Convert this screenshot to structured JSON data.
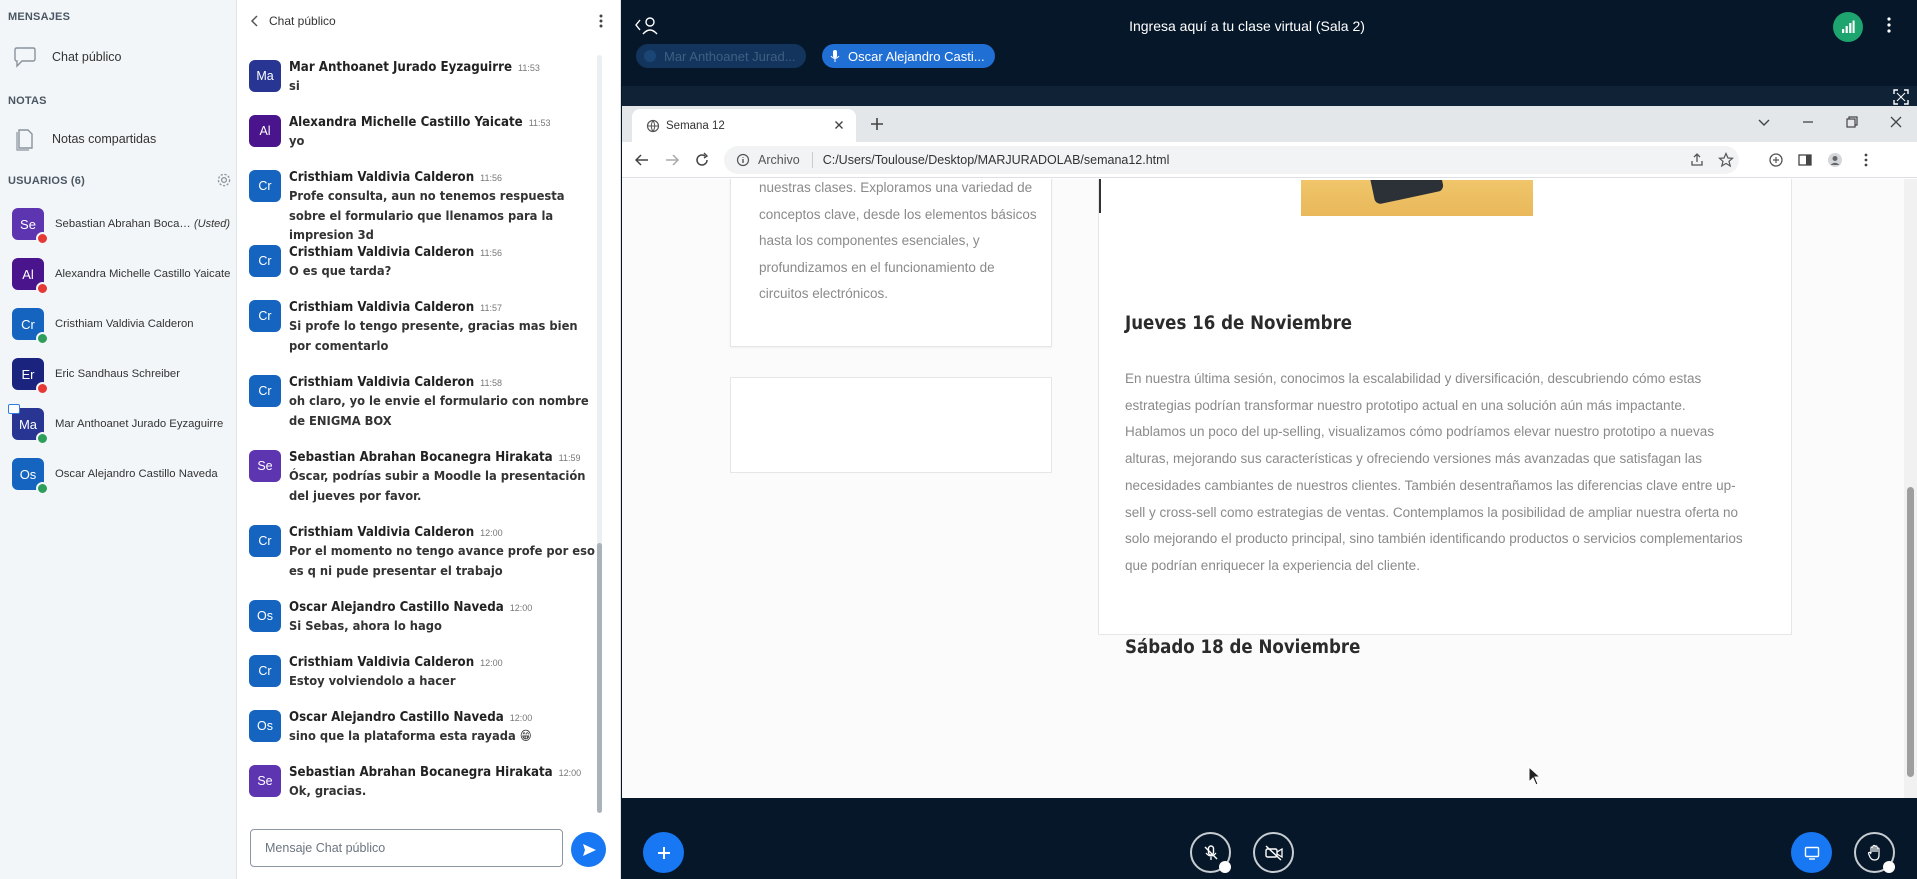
{
  "sidebar": {
    "messages_heading": "MENSAJES",
    "public_chat_label": "Chat público",
    "notes_heading": "NOTAS",
    "shared_notes_label": "Notas compartidas",
    "users_heading": "USUARIOS (6)",
    "users": [
      {
        "initials": "Se",
        "name": "Sebastian Abrahan Bocaneg...",
        "you_label": "(Usted)",
        "color": "#5e35b1",
        "status_color": "#e53935"
      },
      {
        "initials": "Al",
        "name": "Alexandra Michelle Castillo Yaicate",
        "color": "#4a148c",
        "status_color": "#e53935"
      },
      {
        "initials": "Cr",
        "name": "Cristhiam Valdivia Calderon",
        "color": "#1565c0",
        "status_color": "#2e9e5b"
      },
      {
        "initials": "Er",
        "name": "Eric Sandhaus Schreiber",
        "color": "#1a237e",
        "status_color": "#e53935"
      },
      {
        "initials": "Ma",
        "name": "Mar Anthoanet Jurado Eyzaguirre",
        "color": "#283593",
        "status_color": "#2e9e5b"
      },
      {
        "initials": "Os",
        "name": "Oscar Alejandro Castillo Naveda",
        "color": "#1565c0",
        "status_color": "#2e9e5b"
      }
    ]
  },
  "chat": {
    "title": "Chat público",
    "input_placeholder": "Mensaje Chat público",
    "messages": [
      {
        "initials": "Ma",
        "author": "Mar Anthoanet Jurado Eyzaguirre",
        "time": "11:53",
        "text": "si",
        "color": "#283593"
      },
      {
        "initials": "Al",
        "author": "Alexandra Michelle Castillo Yaicate",
        "time": "11:53",
        "text": "yo",
        "color": "#4a148c"
      },
      {
        "initials": "Cr",
        "author": "Cristhiam Valdivia Calderon",
        "time": "11:56",
        "text": "Profe consulta, aun no tenemos respuesta sobre el formulario que llenamos para la impresion 3d",
        "color": "#1565c0"
      },
      {
        "initials": "Cr",
        "author": "Cristhiam Valdivia Calderon",
        "time": "11:56",
        "text": "O es que tarda?",
        "color": "#1565c0"
      },
      {
        "initials": "Cr",
        "author": "Cristhiam Valdivia Calderon",
        "time": "11:57",
        "text": "Si profe lo tengo presente, gracias mas bien por comentarlo",
        "color": "#1565c0"
      },
      {
        "initials": "Cr",
        "author": "Cristhiam Valdivia Calderon",
        "time": "11:58",
        "text": "oh claro, yo le envie el formulario con nombre de ENIGMA BOX",
        "color": "#1565c0"
      },
      {
        "initials": "Se",
        "author": "Sebastian Abrahan Bocanegra Hirakata",
        "time": "11:59",
        "text": "Óscar, podrías subir a Moodle la presentación del jueves por favor.",
        "color": "#5e35b1"
      },
      {
        "initials": "Cr",
        "author": "Cristhiam Valdivia Calderon",
        "time": "12:00",
        "text": "Por el momento no tengo avance profe por eso es q ni pude presentar el trabajo",
        "color": "#1565c0"
      },
      {
        "initials": "Os",
        "author": "Oscar Alejandro Castillo Naveda",
        "time": "12:00",
        "text": "Si Sebas, ahora lo hago",
        "color": "#1565c0"
      },
      {
        "initials": "Cr",
        "author": "Cristhiam Valdivia Calderon",
        "time": "12:00",
        "text": "Estoy volviendolo a hacer",
        "color": "#1565c0"
      },
      {
        "initials": "Os",
        "author": "Oscar Alejandro Castillo Naveda",
        "time": "12:00",
        "text": "sino que la plataforma esta rayada 😁",
        "color": "#1565c0"
      },
      {
        "initials": "Se",
        "author": "Sebastian Abrahan Bocanegra Hirakata",
        "time": "12:00",
        "text": "Ok, gracias.",
        "color": "#5e35b1"
      }
    ]
  },
  "meeting": {
    "title": "Ingresa aquí a tu clase virtual (Sala 2)",
    "talkers": [
      {
        "name": "Mar Anthoanet Jurad...",
        "active": false
      },
      {
        "name": "Oscar Alejandro Casti...",
        "active": true
      }
    ]
  },
  "browser": {
    "tab_title": "Semana 12",
    "archivo_label": "Archivo",
    "url": "C:/Users/Toulouse/Desktop/MARJURADOLAB/semana12.html"
  },
  "webpage": {
    "left_card_text": "nuestras clases. Exploramos una variedad de conceptos clave, desde los elementos básicos hasta los componentes esenciales, y profundizamos en el funcionamiento de circuitos electrónicos.",
    "day1_title": "Jueves 16 de Noviembre",
    "day1_text": "En nuestra última sesión, conocimos la escalabilidad y diversificación, descubriendo cómo estas estrategias podrían transformar nuestro prototipo actual en una solución aún más impactante. Hablamos un poco del up-selling, visualizamos cómo podríamos elevar nuestro prototipo a nuevas alturas, mejorando sus características y ofreciendo versiones más avanzadas que satisfagan las necesidades cambiantes de nuestros clientes. También desentrañamos las diferencias clave entre up-sell y cross-sell como estrategias de ventas. Contemplamos la posibilidad de ampliar nuestra oferta no solo mejorando el producto principal, sino también identificando productos o servicios complementarios que podrían enriquecer la experiencia del cliente.",
    "day2_title": "Sábado 18 de Noviembre"
  },
  "colors": {
    "accent_blue": "#1877f2",
    "dark_bg": "#06172a",
    "connection_green": "#1ea46f"
  }
}
